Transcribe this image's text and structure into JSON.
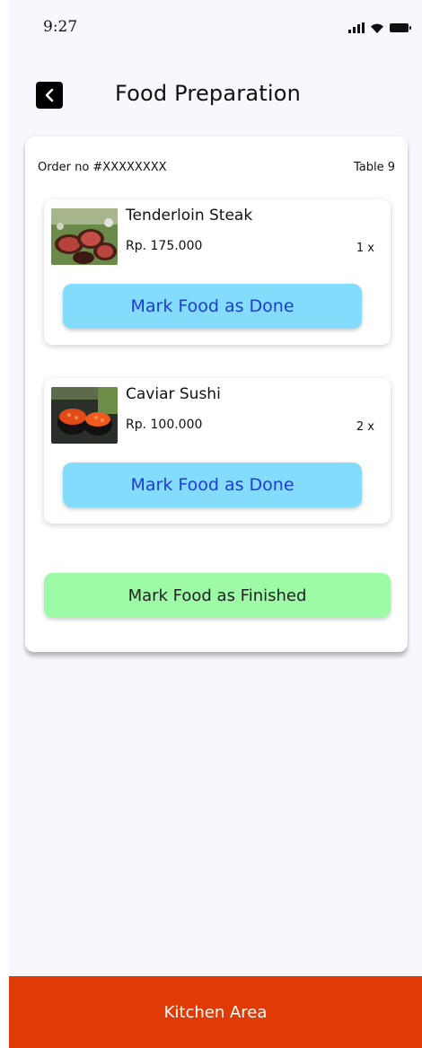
{
  "status_bar": {
    "time": "9:27",
    "icons": [
      "signal-icon",
      "wifi-icon",
      "battery-icon"
    ]
  },
  "header": {
    "title": "Food Preparation",
    "back_icon": "chevron-left-icon"
  },
  "order": {
    "order_no": "Order no #XXXXXXXX",
    "table": "Table 9",
    "items": [
      {
        "name": "Tenderloin Steak",
        "price": "Rp. 175.000",
        "qty": "1 x",
        "image": "steak-photo",
        "button": "Mark Food as Done"
      },
      {
        "name": "Caviar Sushi",
        "price": "Rp. 100.000",
        "qty": "2 x",
        "image": "sushi-photo",
        "button": "Mark Food as Done"
      }
    ],
    "finish_button": "Mark Food as Finished"
  },
  "bottom_bar": {
    "label": "Kitchen Area"
  },
  "colors": {
    "background": "#f7f7fd",
    "done_button": "#84dcfd",
    "done_text": "#1d3bd6",
    "finish_button": "#9dfaa7",
    "bottom_bar": "#e03a06"
  }
}
